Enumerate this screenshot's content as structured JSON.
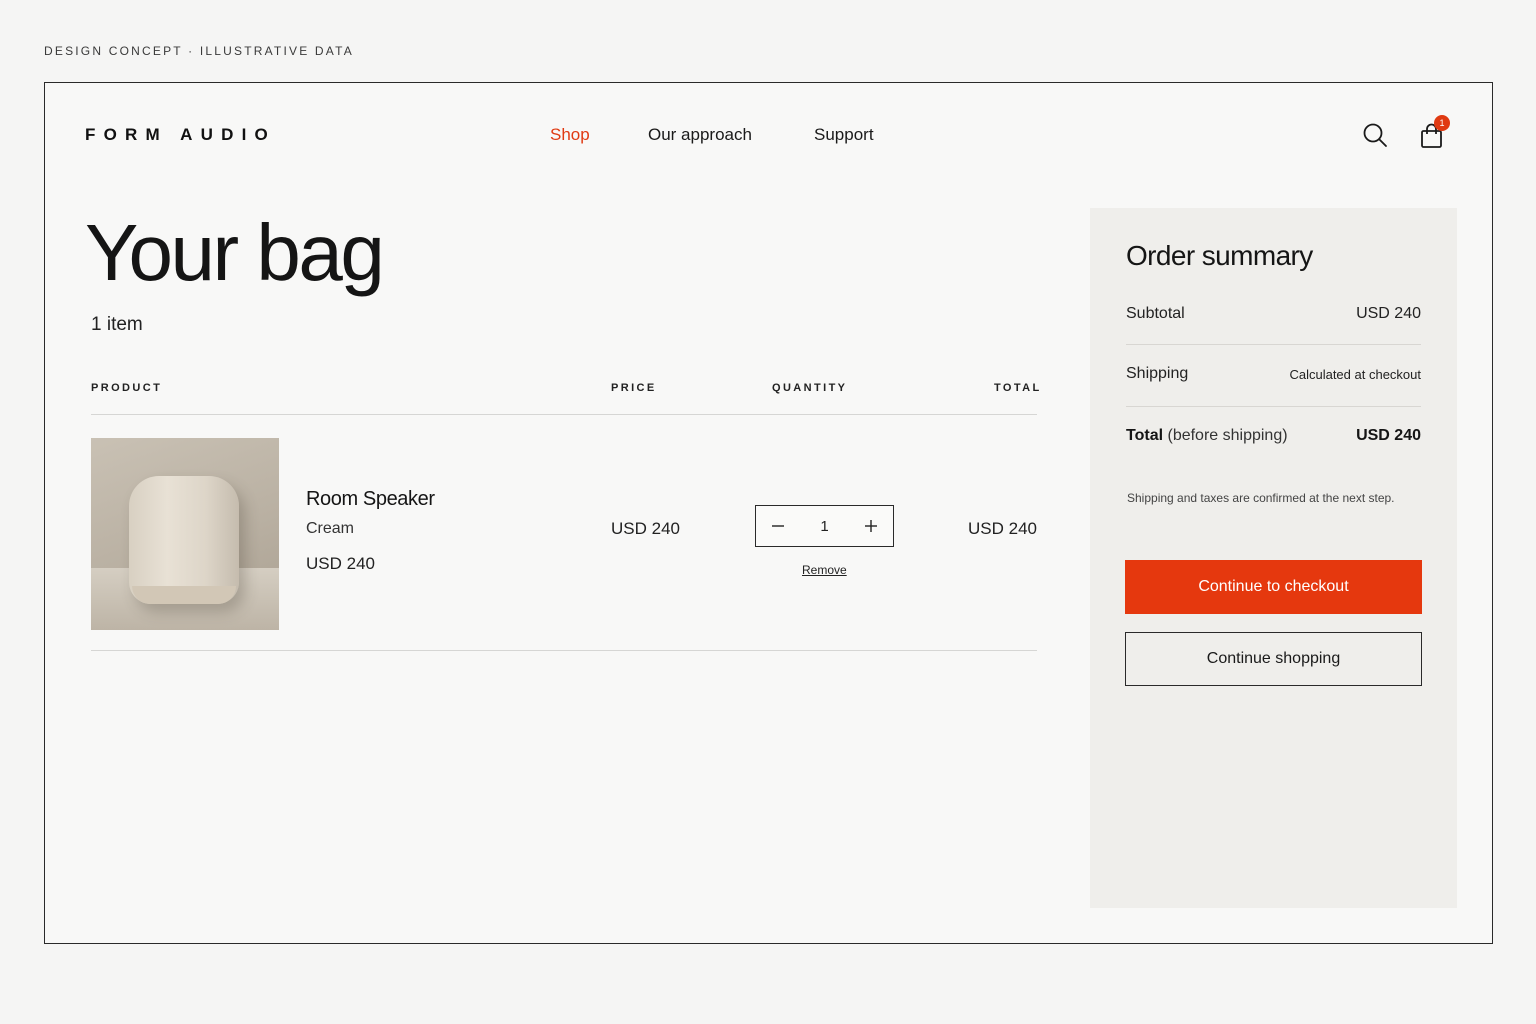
{
  "caption": "DESIGN CONCEPT · ILLUSTRATIVE DATA",
  "header": {
    "logo": "FORM AUDIO",
    "nav": [
      {
        "label": "Shop",
        "active": true
      },
      {
        "label": "Our approach",
        "active": false
      },
      {
        "label": "Support",
        "active": false
      }
    ],
    "cart_count": "1",
    "icons": [
      "search-icon",
      "bag-icon"
    ],
    "accent_color": "#e5380e"
  },
  "bag": {
    "title": "Your bag",
    "item_count": "1 item",
    "columns": {
      "product": "PRODUCT",
      "price": "PRICE",
      "quantity": "QUANTITY",
      "total": "TOTAL"
    },
    "items": [
      {
        "name": "Room Speaker",
        "variant": "Cream",
        "unit_price": "USD 240",
        "price": "USD 240",
        "quantity": "1",
        "total": "USD 240",
        "remove_label": "Remove"
      }
    ]
  },
  "summary": {
    "title": "Order summary",
    "subtotal_label": "Subtotal",
    "subtotal_value": "USD 240",
    "shipping_label": "Shipping",
    "shipping_value": "Calculated at checkout",
    "total_label": "Total",
    "total_qualifier": "(before shipping)",
    "total_value": "USD 240",
    "note": "Shipping and taxes are confirmed at the next step.",
    "checkout_label": "Continue to checkout",
    "continue_label": "Continue shopping"
  }
}
